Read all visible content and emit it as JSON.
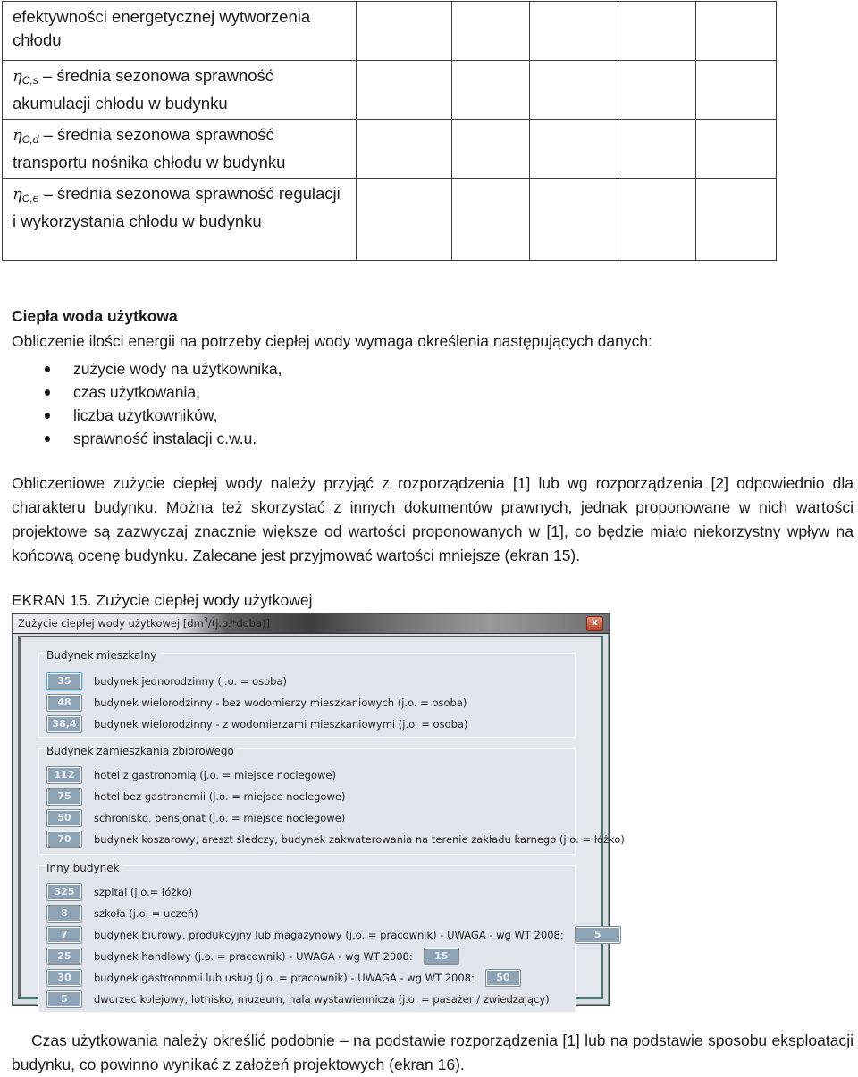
{
  "efficiency_table": {
    "rows": [
      {
        "symbol": "",
        "subscript": "",
        "text": "efektywności energetycznej wytworzenia chłodu"
      },
      {
        "symbol": "η",
        "subscript": "C,s",
        "text": "– średnia sezonowa sprawność akumulacji chłodu w budynku"
      },
      {
        "symbol": "η",
        "subscript": "C,d",
        "text": "– średnia sezonowa sprawność transportu nośnika chłodu w budynku"
      },
      {
        "symbol": "η",
        "subscript": "C,e",
        "text": "– średnia sezonowa sprawność regulacji i wykorzystania chłodu w budynku"
      }
    ]
  },
  "section": {
    "heading": "Ciepła woda użytkowa",
    "intro": "Obliczenie ilości energii na potrzeby ciepłej wody wymaga określenia następujących danych:",
    "bullets": [
      "zużycie wody na użytkownika,",
      "czas użytkowania,",
      "liczba użytkowników,",
      "sprawność instalacji c.w.u."
    ],
    "paragraph": "Obliczeniowe zużycie ciepłej wody należy przyjąć z rozporządzenia [1] lub wg rozporządzenia [2] odpowiednio dla charakteru budynku. Można też skorzystać z innych dokumentów prawnych, jednak proponowane w nich wartości projektowe są zazwyczaj znacznie większe od wartości proponowanych w [1], co będzie miało niekorzystny wpływ na końcową ocenę budynku. Zalecane jest przyjmować wartości mniejsze (ekran 15).",
    "caption": "EKRAN 15. Zużycie ciepłej wody użytkowej",
    "closing_paragraph": "Czas użytkowania należy określić podobnie – na podstawie rozporządzenia [1] lub na podstawie sposobu eksploatacji budynku, co powinno wynikać z założeń projektowych (ekran 16)."
  },
  "dialog": {
    "title_prefix": "Zużycie ciepłej wody użytkowej [dm",
    "title_sup": "3",
    "title_suffix": "/(j.o.*doba)]",
    "close_glyph": "x",
    "groups": [
      {
        "label": "Budynek mieszkalny",
        "items": [
          {
            "value": "35",
            "label": "budynek jednorodzinny (j.o. = osoba)",
            "focused": true
          },
          {
            "value": "48",
            "label": "budynek wielorodzinny - bez wodomierzy mieszkaniowych (j.o. = osoba)"
          },
          {
            "value": "38,4",
            "label": "budynek wielorodzinny - z wodomierzami mieszkaniowymi (j.o. = osoba)"
          }
        ]
      },
      {
        "label": "Budynek zamieszkania zbiorowego",
        "items": [
          {
            "value": "112",
            "label": "hotel z gastronomią (j.o. = miejsce noclegowe)"
          },
          {
            "value": "75",
            "label": "hotel bez gastronomii (j.o. = miejsce noclegowe)"
          },
          {
            "value": "50",
            "label": "schronisko, pensjonat (j.o. = miejsce noclegowe)"
          },
          {
            "value": "70",
            "label": "budynek koszarowy, areszt śledczy, budynek zakwaterowania na terenie zakładu karnego (j.o. = łóżko)"
          }
        ]
      },
      {
        "label": "Inny budynek",
        "items": [
          {
            "value": "325",
            "label": "szpital (j.o.= łóżko)"
          },
          {
            "value": "8",
            "label": "szkoła (j.o. = uczeń)"
          },
          {
            "value": "7",
            "label": "budynek biurowy, produkcyjny lub magazynowy (j.o. = pracownik) - UWAGA - wg WT 2008:",
            "wt2008_value": "5"
          },
          {
            "value": "25",
            "label": "budynek handlowy (j.o. = pracownik) - UWAGA - wg WT 2008:",
            "wt2008_value": "15"
          },
          {
            "value": "30",
            "label": "budynek gastronomii lub usług (j.o. = pracownik) - UWAGA - wg WT 2008:",
            "wt2008_value": "50"
          },
          {
            "value": "5",
            "label": "dworzec kolejowy, lotnisko, muzeum, hala wystawiennicza (j.o. = pasażer / zwiedzający)"
          }
        ]
      }
    ]
  }
}
